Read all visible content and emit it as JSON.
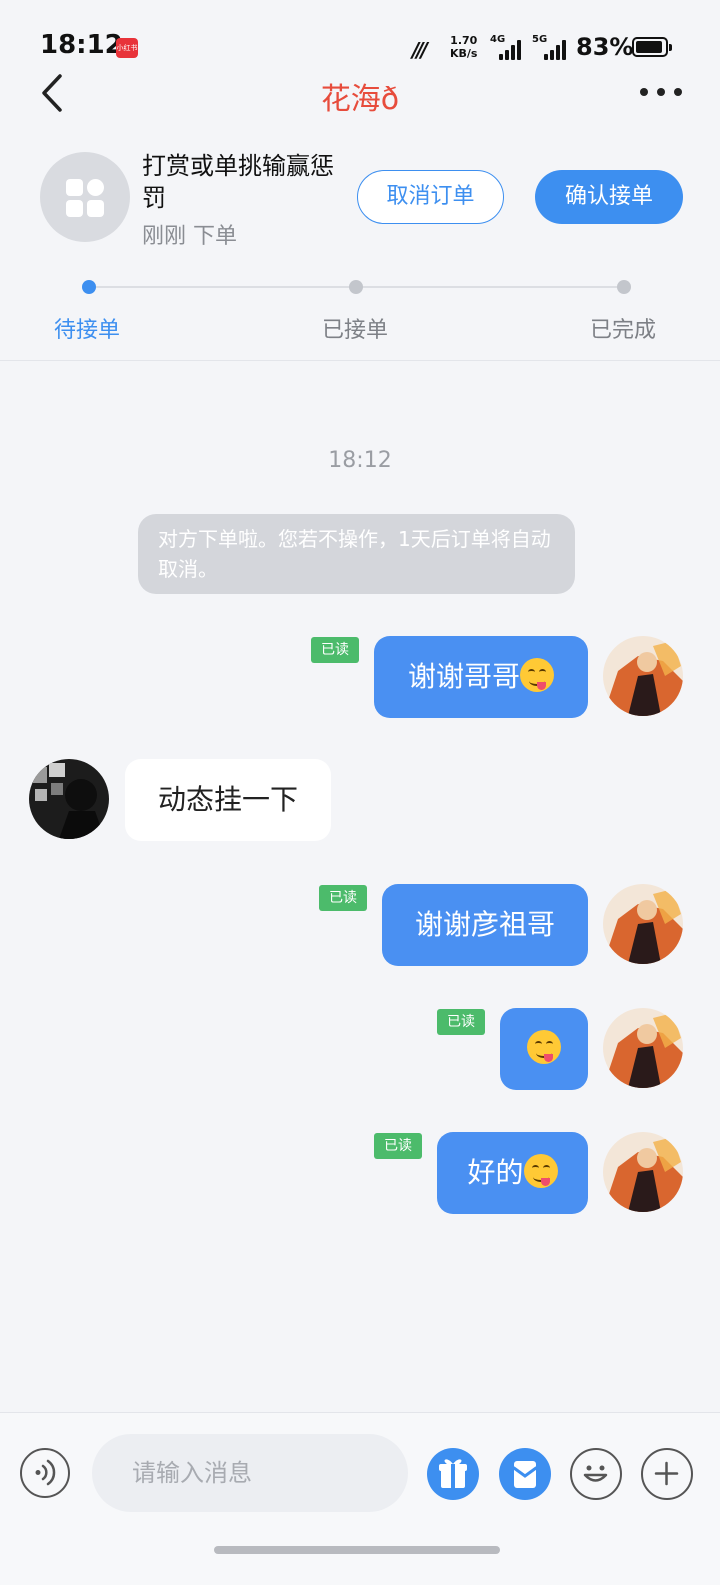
{
  "status_bar": {
    "time": "18:12",
    "app_badge": "小红书",
    "net_speed_value": "1.70",
    "net_speed_unit": "KB/s",
    "signal_1": "4G",
    "signal_2": "5G",
    "battery": "83%"
  },
  "nav": {
    "title": "花海ð"
  },
  "order": {
    "title": "打赏或单挑输赢惩罚",
    "time": "刚刚 下单",
    "cancel_label": "取消订单",
    "confirm_label": "确认接单"
  },
  "progress": {
    "steps": [
      {
        "label": "待接单",
        "active": true
      },
      {
        "label": "已接单",
        "active": false
      },
      {
        "label": "已完成",
        "active": false
      }
    ],
    "active_color": "#3d8ff0"
  },
  "chat": {
    "timestamp": "18:12",
    "system_message": "对方下单啦。您若不操作，1天后订单将自动取消。",
    "messages": [
      {
        "direction": "out",
        "text": "谢谢哥哥",
        "emoji": "yum-face",
        "read": "已读"
      },
      {
        "direction": "in",
        "text": "动态挂一下"
      },
      {
        "direction": "out",
        "text": "谢谢彦祖哥",
        "read": "已读"
      },
      {
        "direction": "out",
        "text": "",
        "emoji": "yum-face",
        "read": "已读"
      },
      {
        "direction": "out",
        "text": "好的",
        "emoji": "yum-face",
        "read": "已读"
      }
    ]
  },
  "input": {
    "placeholder": "请输入消息",
    "value": ""
  },
  "colors": {
    "accent": "#3d8ff0",
    "title_red": "#e74c3c",
    "read_green": "#4cbb6b"
  }
}
